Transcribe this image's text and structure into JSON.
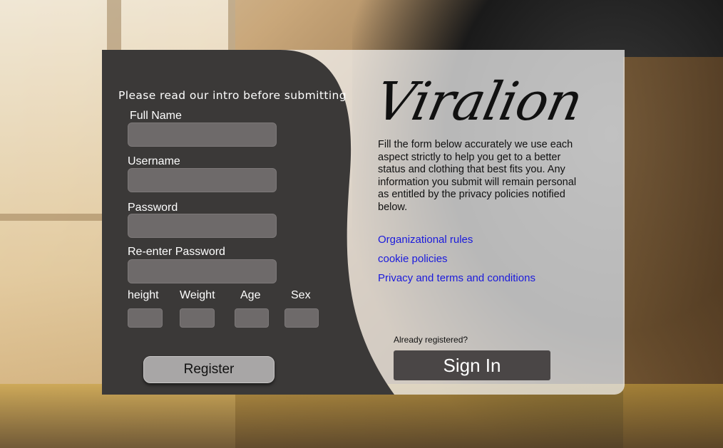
{
  "theme": {
    "dark_panel": "#3b3938",
    "field_fill": "#6e6a6a",
    "link_color": "#1a1adc",
    "signin_fill": "#4a4646",
    "register_fill": "#a8a6a6"
  },
  "registration": {
    "intro": "Please read our intro before submitting",
    "fields": {
      "full_name_label": "Full Name",
      "username_label": "Username",
      "password_label": "Password",
      "reenter_password_label": "Re-enter Password",
      "height_label": "height",
      "weight_label": "Weight",
      "age_label": "Age",
      "sex_label": "Sex"
    },
    "register_label": "Register"
  },
  "info": {
    "logo": "Viralion",
    "description": "Fill the form below accurately we use each aspect strictly to help you get to a better status and clothing that best fits you. Any information you submit will remain personal as entitled by the privacy policies notified below.",
    "links": [
      "Organizational rules",
      "cookie policies",
      "Privacy and terms and conditions"
    ],
    "already_registered": "Already registered?",
    "signin_label": "Sign In"
  }
}
